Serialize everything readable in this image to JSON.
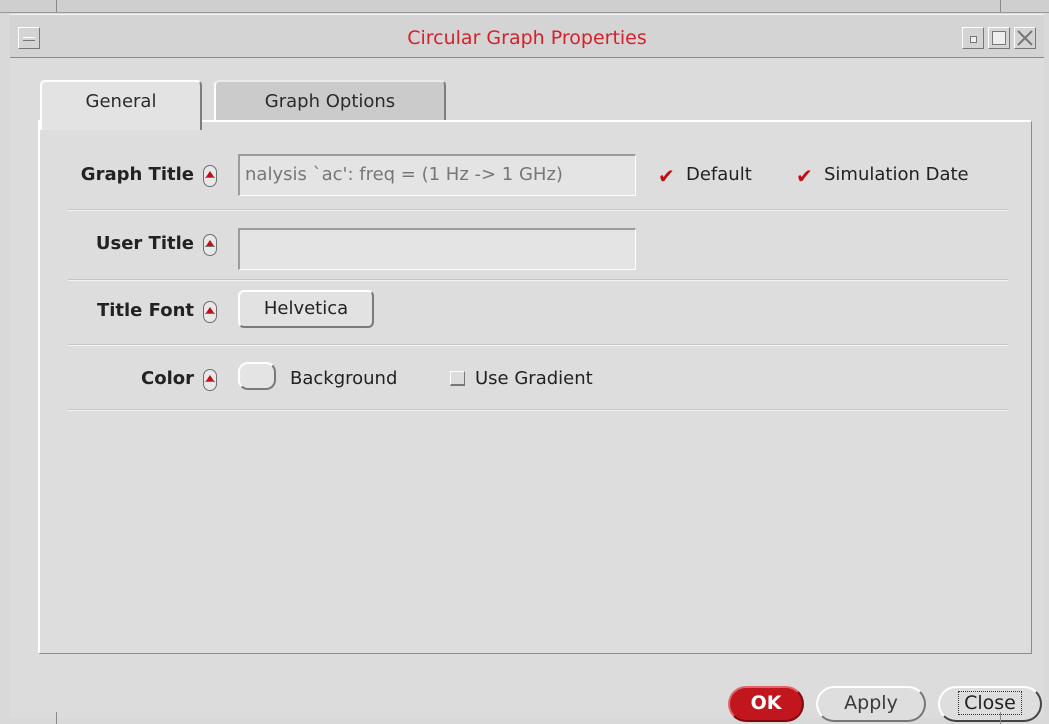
{
  "window": {
    "title": "Circular Graph Properties"
  },
  "tabs": [
    {
      "label": "General",
      "active": true
    },
    {
      "label": "Graph Options",
      "active": false
    }
  ],
  "general": {
    "graph_title": {
      "label": "Graph Title",
      "value": "nalysis `ac': freq = (1 Hz -> 1 GHz)",
      "default_label": "Default",
      "default_checked": true,
      "sim_date_label": "Simulation Date",
      "sim_date_checked": true
    },
    "user_title": {
      "label": "User Title",
      "value": ""
    },
    "title_font": {
      "label": "Title Font",
      "value": "Helvetica"
    },
    "color": {
      "label": "Color",
      "background_label": "Background",
      "gradient_label": "Use Gradient",
      "gradient_checked": false
    }
  },
  "buttons": {
    "ok": "OK",
    "apply": "Apply",
    "close": "Close"
  },
  "colors": {
    "title_text": "#d4212c",
    "ok_button": "#c1161e",
    "check_mark": "#c20d14"
  }
}
